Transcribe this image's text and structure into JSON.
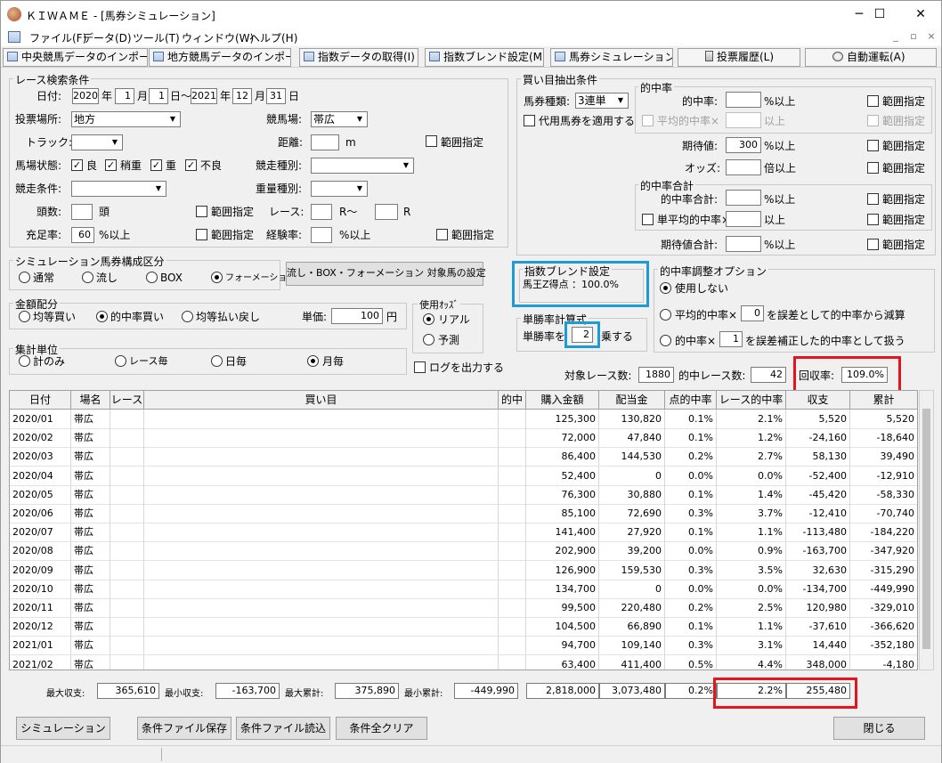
{
  "window": {
    "title": "ＫＩＷＡＭＥ - [馬券シミュレーション]",
    "minimize": "─",
    "maximize": "☐",
    "close": "✕"
  },
  "menu": [
    "ファイル(F)",
    "データ(D)",
    "ツール(T)",
    "ウィンドウ(W)",
    "ヘルプ(H)"
  ],
  "mdi": {
    "minimize": "_",
    "restore": "▫",
    "close": "×"
  },
  "toolbar": [
    "中央競馬データのインポート(J)",
    "地方競馬データのインポート(N)",
    "指数データの取得(I)",
    "指数ブレンド設定(M)",
    "馬券シミュレーション(B)",
    "投票履歴(L)",
    "自動運転(A)"
  ],
  "race_search": {
    "legend": "レース検索条件",
    "date_label": "日付:",
    "year_from": "2020",
    "year_lbl": "年",
    "month_from": "1",
    "month_lbl": "月",
    "day_from": "1",
    "day_tilde": "日〜",
    "year_to": "2021",
    "month_to": "12",
    "day_to": "31",
    "day_lbl": "日",
    "venue_label": "投票場所:",
    "venue_value": "地方",
    "track_name_label": "競馬場:",
    "track_name_value": "帯広",
    "track_label": "トラック:",
    "distance_label": "距離:",
    "distance_unit": "m",
    "range1": "範囲指定",
    "condition_label": "馬場状態:",
    "cond_good": "良",
    "cond_slight": "稍重",
    "cond_heavy": "重",
    "cond_bad": "不良",
    "race_type_label": "競走種別:",
    "race_cond_label": "競走条件:",
    "weight_label": "重量種別:",
    "heads_label": "頭数:",
    "heads_unit": "頭",
    "range2": "範囲指定",
    "race_label": "レース:",
    "race_r1": "R〜",
    "race_r2": "R",
    "fill_label": "充足率:",
    "fill_value": "60",
    "fill_unit": "%以上",
    "range3": "範囲指定",
    "exp_label": "経験率:",
    "exp_unit": "%以上",
    "range4": "範囲指定"
  },
  "sim_type": {
    "legend": "シミュレーション馬券構成区分",
    "opts": [
      "通常",
      "流し",
      "BOX",
      "フォーメーション"
    ],
    "button": "流し・BOX・フォーメーション 対象馬の設定"
  },
  "money": {
    "legend": "金額配分",
    "opts": [
      "均等買い",
      "的中率買い",
      "均等払い戻し"
    ],
    "unit_label": "単価:",
    "unit_value": "100",
    "unit_yen": "円"
  },
  "odds": {
    "legend": "使用ｵｯｽﾞ",
    "opts": [
      "リアル",
      "予測"
    ]
  },
  "agg": {
    "legend": "集計単位",
    "opts": [
      "計のみ",
      "レース毎",
      "日毎",
      "月毎"
    ],
    "log": "ログを出力する"
  },
  "buy": {
    "legend": "買い目抽出条件",
    "ticket_label": "馬券種類:",
    "ticket_value": "3連単",
    "proxy": "代用馬券を適用する",
    "hit_legend": "的中率",
    "hit_label": "的中率:",
    "hit_unit": "%以上",
    "avg_hit": "平均的中率×",
    "avg_unit": "以上",
    "ev_label": "期待値:",
    "ev_value": "300",
    "ev_unit": "%以上",
    "odds_label": "オッズ:",
    "odds_unit": "倍以上",
    "sum_legend": "的中率合計",
    "sum_label": "的中率合計:",
    "sum_unit": "%以上",
    "single_avg": "単平均的中率×",
    "single_unit": "以上",
    "ev_sum_label": "期待値合計:",
    "ev_sum_unit": "%以上",
    "range": "範囲指定"
  },
  "blend": {
    "legend": "指数ブレンド設定",
    "text": "馬王Z得点 ：100.0%"
  },
  "adjust": {
    "legend": "的中率調整オプション",
    "opt1": "使用しない",
    "opt2a": "平均的中率×",
    "opt2_val": "0",
    "opt2b": "を誤差として的中率から減算",
    "opt3a": "的中率×",
    "opt3_val": "1",
    "opt3b": "を誤差補正した的中率として扱う"
  },
  "win_calc": {
    "legend": "単勝率計算式",
    "label": "単勝率を",
    "value": "2",
    "suffix": "乗する"
  },
  "summary": {
    "target_label": "対象レース数:",
    "target": "1880",
    "hit_label": "的中レース数:",
    "hit": "42",
    "recovery_label": "回収率:",
    "recovery": "109.0%"
  },
  "table": {
    "headers": [
      "日付",
      "場名",
      "レース",
      "買い目",
      "的中",
      "購入金額",
      "配当金",
      "点的中率",
      "レース的中率",
      "収支",
      "累計"
    ],
    "rows": [
      [
        "2020/01",
        "帯広",
        "",
        "",
        "",
        "125,300",
        "130,820",
        "0.1%",
        "2.1%",
        "5,520",
        "5,520"
      ],
      [
        "2020/02",
        "帯広",
        "",
        "",
        "",
        "72,000",
        "47,840",
        "0.1%",
        "1.2%",
        "-24,160",
        "-18,640"
      ],
      [
        "2020/03",
        "帯広",
        "",
        "",
        "",
        "86,400",
        "144,530",
        "0.2%",
        "2.7%",
        "58,130",
        "39,490"
      ],
      [
        "2020/04",
        "帯広",
        "",
        "",
        "",
        "52,400",
        "0",
        "0.0%",
        "0.0%",
        "-52,400",
        "-12,910"
      ],
      [
        "2020/05",
        "帯広",
        "",
        "",
        "",
        "76,300",
        "30,880",
        "0.1%",
        "1.4%",
        "-45,420",
        "-58,330"
      ],
      [
        "2020/06",
        "帯広",
        "",
        "",
        "",
        "85,100",
        "72,690",
        "0.3%",
        "3.7%",
        "-12,410",
        "-70,740"
      ],
      [
        "2020/07",
        "帯広",
        "",
        "",
        "",
        "141,400",
        "27,920",
        "0.1%",
        "1.1%",
        "-113,480",
        "-184,220"
      ],
      [
        "2020/08",
        "帯広",
        "",
        "",
        "",
        "202,900",
        "39,200",
        "0.0%",
        "0.9%",
        "-163,700",
        "-347,920"
      ],
      [
        "2020/09",
        "帯広",
        "",
        "",
        "",
        "126,900",
        "159,530",
        "0.3%",
        "3.5%",
        "32,630",
        "-315,290"
      ],
      [
        "2020/10",
        "帯広",
        "",
        "",
        "",
        "134,700",
        "0",
        "0.0%",
        "0.0%",
        "-134,700",
        "-449,990"
      ],
      [
        "2020/11",
        "帯広",
        "",
        "",
        "",
        "99,500",
        "220,480",
        "0.2%",
        "2.5%",
        "120,980",
        "-329,010"
      ],
      [
        "2020/12",
        "帯広",
        "",
        "",
        "",
        "104,500",
        "66,890",
        "0.1%",
        "1.1%",
        "-37,610",
        "-366,620"
      ],
      [
        "2021/01",
        "帯広",
        "",
        "",
        "",
        "94,700",
        "109,140",
        "0.3%",
        "3.1%",
        "14,440",
        "-352,180"
      ],
      [
        "2021/02",
        "帯広",
        "",
        "",
        "",
        "63,400",
        "411,400",
        "0.5%",
        "4.4%",
        "348,000",
        "-4,180"
      ]
    ]
  },
  "totals": {
    "max_label": "最大収支:",
    "max": "365,610",
    "min_label": "最小収支:",
    "min": "-163,700",
    "maxcum_label": "最大累計:",
    "maxcum": "375,890",
    "mincum_label": "最小累計:",
    "mincum": "-449,990",
    "buy": "2,818,000",
    "pay": "3,073,480",
    "point": "0.2%",
    "race": "2.2%",
    "balance": "255,480"
  },
  "buttons": {
    "simulate": "シミュレーション",
    "save": "条件ファイル保存",
    "load": "条件ファイル読込",
    "clear": "条件全クリア",
    "close": "閉じる"
  },
  "colors": {
    "highlight_red": "#e4161d",
    "highlight_blue": "#1e9bd7"
  }
}
